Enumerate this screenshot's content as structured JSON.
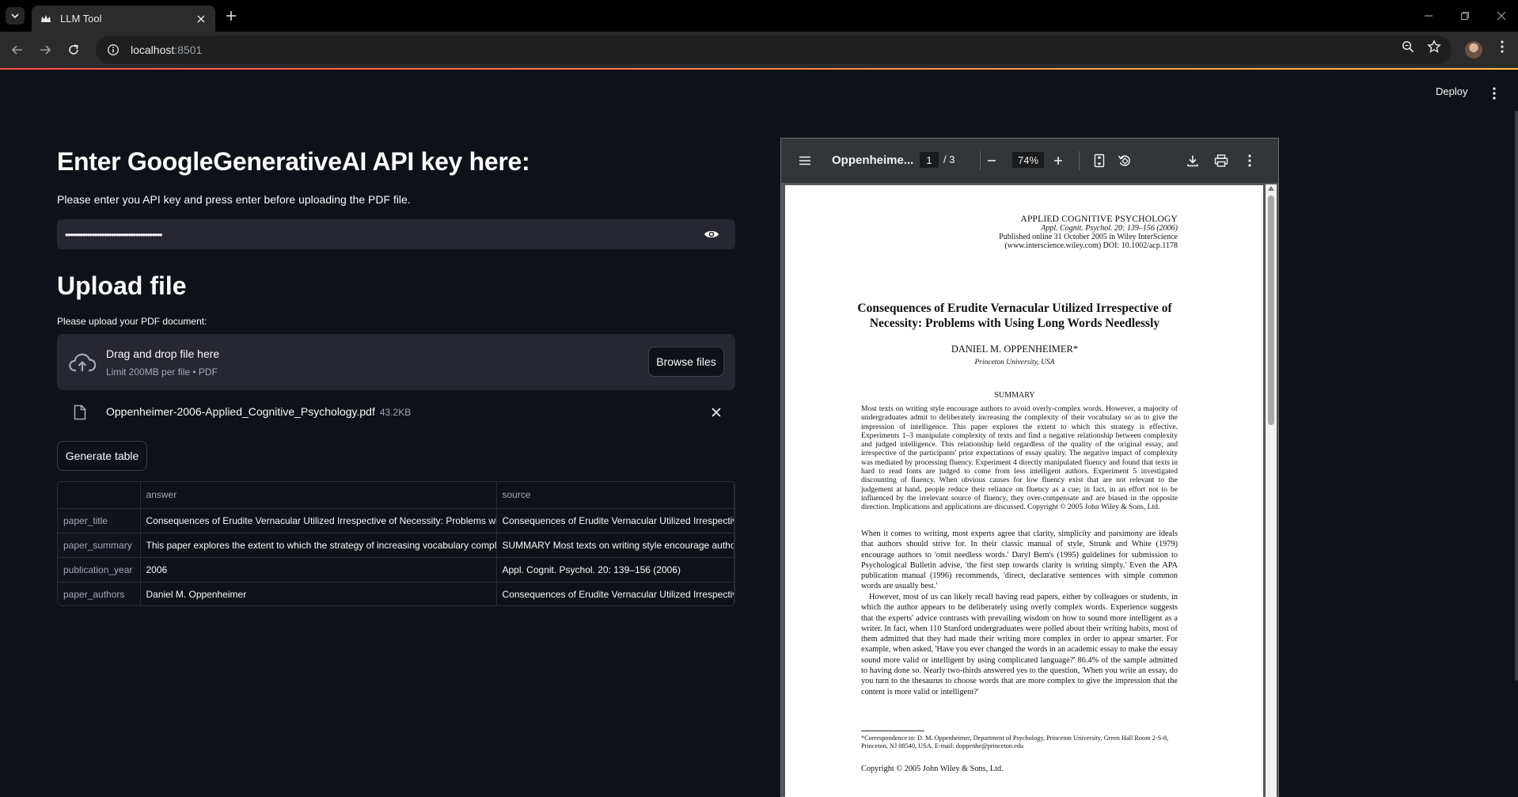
{
  "browser": {
    "tab_title": "LLM Tool",
    "url_host": "localhost",
    "url_port": ":8501"
  },
  "app": {
    "deploy_label": "Deploy"
  },
  "api_section": {
    "heading": "Enter GoogleGenerativeAI API key here:",
    "instruction": "Please enter you API key and press enter before uploading the PDF file.",
    "masked_value": "••••••••••••••••••••••••••••••••••••••••"
  },
  "upload_section": {
    "heading": "Upload file",
    "label": "Please upload your PDF document:",
    "drop_title": "Drag and drop file here",
    "drop_limit": "Limit 200MB per file • PDF",
    "browse_label": "Browse files",
    "file_name": "Oppenheimer-2006-Applied_Cognitive_Psychology.pdf",
    "file_size": "43.2KB"
  },
  "generate_label": "Generate table",
  "result_table": {
    "columns": [
      "",
      "answer",
      "source"
    ],
    "rows": [
      {
        "key": "paper_title",
        "answer": "Consequences of Erudite Vernacular Utilized Irrespective of Necessity: Problems with",
        "source": "Consequences of Erudite Vernacular Utilized Irrespective"
      },
      {
        "key": "paper_summary",
        "answer": "This paper explores the extent to which the strategy of increasing vocabulary comple",
        "source": "SUMMARY Most texts on writing style encourage authors"
      },
      {
        "key": "publication_year",
        "answer": "2006",
        "source": "Appl. Cognit. Psychol. 20: 139–156 (2006)"
      },
      {
        "key": "paper_authors",
        "answer": "Daniel M. Oppenheimer",
        "source": "Consequences of Erudite Vernacular Utilized Irrespective"
      }
    ]
  },
  "pdf_viewer": {
    "title": "Oppenheime...",
    "current_page": "1",
    "total_pages": "/ 3",
    "zoom": "74%",
    "page": {
      "journal": "APPLIED COGNITIVE PSYCHOLOGY",
      "citation": "Appl. Cognit. Psychol. 20: 139–156 (2006)",
      "published": "Published online 31 October 2005 in Wiley InterScience",
      "doi": "(www.interscience.wiley.com) DOI: 10.1002/acp.1178",
      "title": "Consequences of Erudite Vernacular Utilized Irrespective of Necessity: Problems with Using Long Words Needlessly",
      "author": "DANIEL M. OPPENHEIMER*",
      "affiliation": "Princeton University, USA",
      "summary_heading": "SUMMARY",
      "summary": "Most texts on writing style encourage authors to avoid overly-complex words. However, a majority of undergraduates admit to deliberately increasing the complexity of their vocabulary so as to give the impression of intelligence. This paper explores the extent to which this strategy is effective. Experiments 1–3 manipulate complexity of texts and find a negative relationship between complexity and judged intelligence. This relationship held regardless of the quality of the original essay, and irrespective of the participants' prior expectations of essay quality. The negative impact of complexity was mediated by processing fluency. Experiment 4 directly manipulated fluency and found that texts in hard to read fonts are judged to come from less intelligent authors. Experiment 5 investigated discounting of fluency. When obvious causes for low fluency exist that are not relevant to the judgement at hand, people reduce their reliance on fluency as a cue; in fact, in an effort not to be influenced by the irrelevant source of fluency, they over-compensate and are biased in the opposite direction. Implications and applications are discussed. Copyright © 2005 John Wiley & Sons, Ltd.",
      "body1": "When it comes to writing, most experts agree that clarity, simplicity and parsimony are ideals that authors should strive for. In their classic manual of style, Strunk and White (1979) encourage authors to 'omit needless words.' Daryl Bem's (1995) guidelines for submission to Psychological Bulletin advise, 'the first step towards clarity is writing simply.' Even the APA publication manual (1996) recommends, 'direct, declarative sentences with simple common words are usually best.'",
      "body2": "However, most of us can likely recall having read papers, either by colleagues or students, in which the author appears to be deliberately using overly complex words. Experience suggests that the experts' advice contrasts with prevailing wisdom on how to sound more intelligent as a writer. In fact, when 110 Stanford undergraduates were polled about their writing habits, most of them admitted that they had made their writing more complex in order to appear smarter. For example, when asked, 'Have you ever changed the words in an academic essay to make the essay sound more valid or intelligent by using complicated language?' 86.4% of the sample admitted to having done so. Nearly two-thirds answered yes to the question, 'When you write an essay, do you turn to the thesaurus to choose words that are more complex to give the impression that the content is more valid or intelligent?'",
      "footnote": "*Correspondence to: D. M. Oppenheimer, Department of Psychology, Princeton University, Green Hall Room 2-S-8, Princeton, NJ 08540, USA. E-mail: doppenhe@princeton.edu",
      "copyright": "Copyright © 2005 John Wiley & Sons, Ltd."
    }
  },
  "colors": {
    "app_bg": "#0e1117",
    "widget_bg": "#262730",
    "accent_gradient_start": "#ff4b4b",
    "accent_gradient_end": "#ffbd45"
  }
}
